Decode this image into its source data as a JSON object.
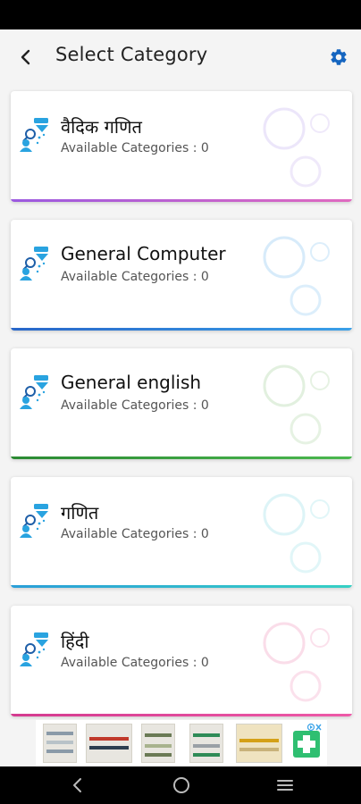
{
  "header": {
    "title": "Select Category",
    "back_icon": "back-arrow-icon",
    "settings_icon": "gear-icon",
    "settings_color": "#1565c0"
  },
  "categories": [
    {
      "title": "वैदिक गणित",
      "subtitle": "Available Categories : 0",
      "accent": "#c455d8"
    },
    {
      "title": "General Computer",
      "subtitle": "Available Categories : 0",
      "accent": "#2f7fd6"
    },
    {
      "title": "General english",
      "subtitle": "Available Categories : 0",
      "accent": "#2e9b3a"
    },
    {
      "title": "गणित",
      "subtitle": "Available Categories : 0",
      "accent": "#2bc0cc"
    },
    {
      "title": "हिंदी",
      "subtitle": "Available Categories : 0",
      "accent": "#e14a9c"
    }
  ],
  "ad": {
    "brand_icon": "medical-cross-icon",
    "adchoices_icon": "adchoices-icon"
  },
  "nav": {
    "back_icon": "nav-back-icon",
    "home_icon": "nav-home-icon",
    "menu_icon": "nav-menu-icon"
  }
}
